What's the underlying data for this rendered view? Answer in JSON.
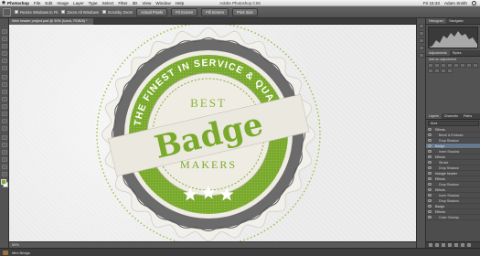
{
  "menubar": {
    "app_name": "Photoshop",
    "items": [
      "File",
      "Edit",
      "Image",
      "Layer",
      "Type",
      "Select",
      "Filter",
      "3D",
      "View",
      "Window",
      "Help"
    ],
    "window_title": "Adobe Photoshop CS6",
    "clock": "Fri 15:33",
    "user": "Adam Smith"
  },
  "options_bar": {
    "chk1": "Resize Windows to Fit",
    "chk2": "Zoom All Windows",
    "chk3": "Scrubby Zoom",
    "btn1": "Actual Pixels",
    "btn2": "Fit Screen",
    "btn3": "Fill Screen",
    "btn4": "Print Size"
  },
  "document": {
    "tab_label": "Web header project.psd @ 50% (Icons, RGB/8) *",
    "status": "50%"
  },
  "badge": {
    "arc_text": "THE FINEST IN SERVICE & QUALITY",
    "best": "BEST",
    "badge_word": "Badge",
    "makers": "MAKERS",
    "green": "#7aaa2c",
    "gray": "#6b6b6b",
    "cream": "#efece4"
  },
  "panels": {
    "top_tabs": [
      "Histogram",
      "Navigator"
    ],
    "adjust_tabs": [
      "Adjustments",
      "Styles"
    ],
    "adjust_label": "Add an adjustment",
    "layer_tabs": [
      "Layers",
      "Channels",
      "Paths"
    ],
    "search_kind": "Kind",
    "layers": [
      {
        "name": "Effects",
        "sub": false
      },
      {
        "name": "Bevel & Emboss",
        "sub": true
      },
      {
        "name": "Drop Shadow",
        "sub": true
      },
      {
        "name": "Badge",
        "sub": false
      },
      {
        "name": "Inner Shadow",
        "sub": true
      },
      {
        "name": "Effects",
        "sub": false
      },
      {
        "name": "Stroke",
        "sub": true
      },
      {
        "name": "Drop Shadow",
        "sub": true
      },
      {
        "name": "triangle header",
        "sub": false
      },
      {
        "name": "Effects",
        "sub": false
      },
      {
        "name": "Drop Shadow",
        "sub": true
      },
      {
        "name": "Effects",
        "sub": false
      },
      {
        "name": "Inner Shadow",
        "sub": true
      },
      {
        "name": "Drop Shadow",
        "sub": true
      },
      {
        "name": "Badge",
        "sub": false
      },
      {
        "name": "Effects",
        "sub": false
      },
      {
        "name": "Color Overlay",
        "sub": true
      },
      {
        "name": "Gradient Overlay",
        "sub": true
      },
      {
        "name": "Drop Shadow",
        "sub": true
      },
      {
        "name": "Background",
        "sub": false
      }
    ]
  },
  "bottom": {
    "mini_bridge": "Mini Bridge"
  }
}
